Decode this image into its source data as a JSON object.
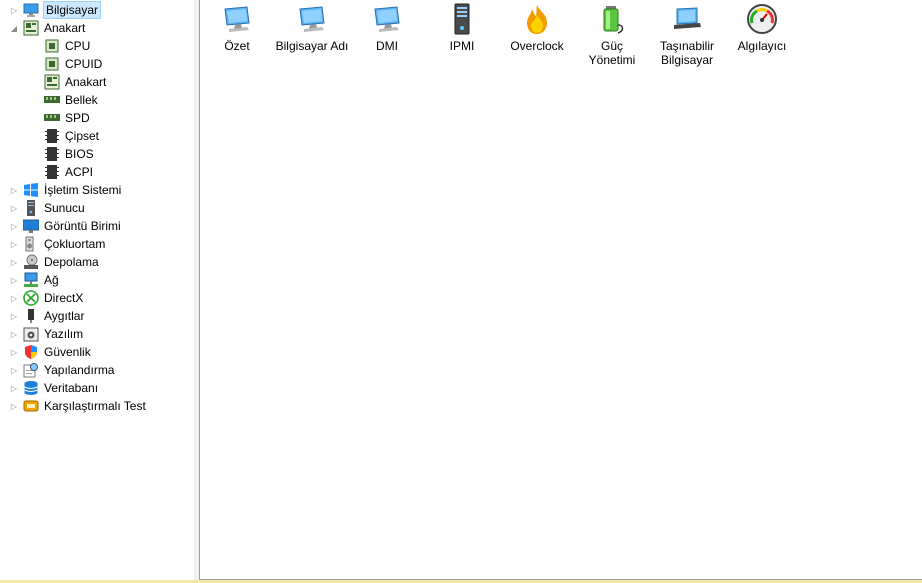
{
  "tree": {
    "items": [
      {
        "label": "Bilgisayar",
        "icon": "computer-icon",
        "expander": "▷",
        "level": 0,
        "selected": true
      },
      {
        "label": "Anakart",
        "icon": "motherboard-icon",
        "expander": "◢",
        "level": 0
      },
      {
        "label": "CPU",
        "icon": "cpu-icon",
        "expander": "",
        "level": 1
      },
      {
        "label": "CPUID",
        "icon": "cpu-icon",
        "expander": "",
        "level": 1
      },
      {
        "label": "Anakart",
        "icon": "motherboard-icon",
        "expander": "",
        "level": 1
      },
      {
        "label": "Bellek",
        "icon": "memory-icon",
        "expander": "",
        "level": 1
      },
      {
        "label": "SPD",
        "icon": "memory-icon",
        "expander": "",
        "level": 1
      },
      {
        "label": "Çipset",
        "icon": "chip-icon",
        "expander": "",
        "level": 1
      },
      {
        "label": "BIOS",
        "icon": "chip-icon",
        "expander": "",
        "level": 1
      },
      {
        "label": "ACPI",
        "icon": "chip-icon",
        "expander": "",
        "level": 1
      },
      {
        "label": "İşletim Sistemi",
        "icon": "windows-icon",
        "expander": "▷",
        "level": 0
      },
      {
        "label": "Sunucu",
        "icon": "server-icon",
        "expander": "▷",
        "level": 0
      },
      {
        "label": "Görüntü Birimi",
        "icon": "monitor-icon",
        "expander": "▷",
        "level": 0
      },
      {
        "label": "Çokluortam",
        "icon": "speaker-icon",
        "expander": "▷",
        "level": 0
      },
      {
        "label": "Depolama",
        "icon": "storage-icon",
        "expander": "▷",
        "level": 0
      },
      {
        "label": "Ağ",
        "icon": "network-icon",
        "expander": "▷",
        "level": 0
      },
      {
        "label": "DirectX",
        "icon": "xbox-icon",
        "expander": "▷",
        "level": 0
      },
      {
        "label": "Aygıtlar",
        "icon": "device-icon",
        "expander": "▷",
        "level": 0
      },
      {
        "label": "Yazılım",
        "icon": "software-icon",
        "expander": "▷",
        "level": 0
      },
      {
        "label": "Güvenlik",
        "icon": "shield-icon",
        "expander": "▷",
        "level": 0
      },
      {
        "label": "Yapılandırma",
        "icon": "config-icon",
        "expander": "▷",
        "level": 0
      },
      {
        "label": "Veritabanı",
        "icon": "database-icon",
        "expander": "▷",
        "level": 0
      },
      {
        "label": "Karşılaştırmalı Test",
        "icon": "benchmark-icon",
        "expander": "▷",
        "level": 0
      }
    ]
  },
  "content": {
    "items": [
      {
        "label": "Özet",
        "icon": "computer-icon"
      },
      {
        "label": "Bilgisayar Adı",
        "icon": "computer-icon"
      },
      {
        "label": "DMI",
        "icon": "computer-icon"
      },
      {
        "label": "IPMI",
        "icon": "server-icon"
      },
      {
        "label": "Overclock",
        "icon": "flame-icon"
      },
      {
        "label": "Güç\nYönetimi",
        "icon": "battery-icon"
      },
      {
        "label": "Taşınabilir\nBilgisayar",
        "icon": "laptop-icon"
      },
      {
        "label": "Algılayıcı",
        "icon": "gauge-icon"
      }
    ]
  },
  "colors": {
    "window_border": "#f4e6a8",
    "selection": "#cce8ff",
    "selection_border": "#99d1ff",
    "icon_blue": "#3a9be8"
  }
}
